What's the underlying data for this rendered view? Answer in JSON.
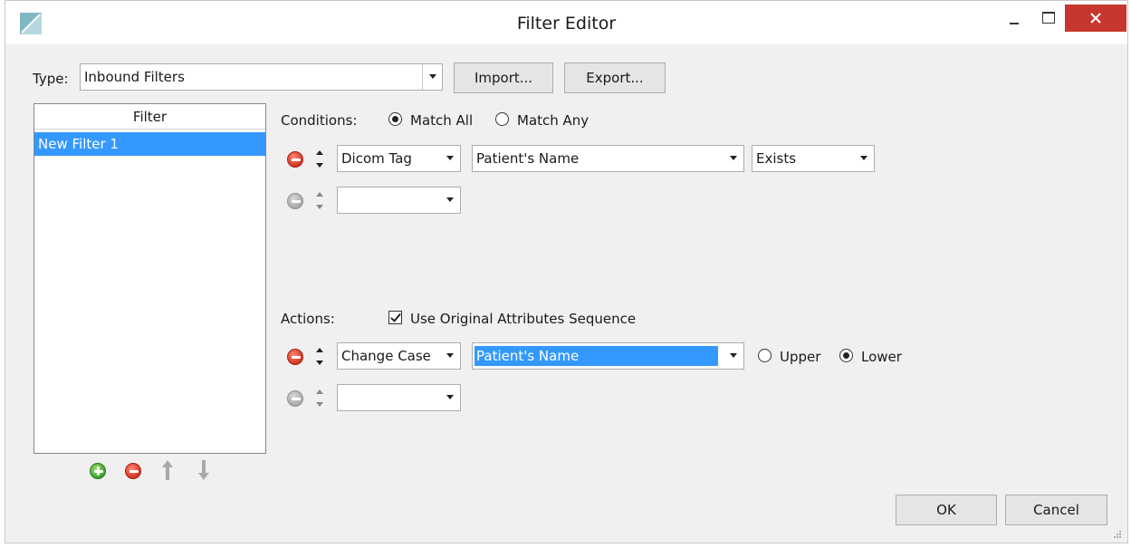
{
  "window": {
    "title": "Filter Editor"
  },
  "type_row": {
    "label": "Type:",
    "value": "Inbound Filters",
    "import_label": "Import...",
    "export_label": "Export..."
  },
  "filter_list": {
    "header": "Filter",
    "items": [
      "New Filter 1"
    ]
  },
  "conditions": {
    "label": "Conditions:",
    "match_all_label": "Match All",
    "match_any_label": "Match Any",
    "selected": "Match All",
    "row1": {
      "field": "Dicom Tag",
      "tag": "Patient's Name",
      "op": "Exists"
    },
    "row2": {
      "field": ""
    }
  },
  "actions": {
    "label": "Actions:",
    "use_original_label": "Use Original Attributes Sequence",
    "use_original_checked": true,
    "row1": {
      "action": "Change Case",
      "tag": "Patient's Name",
      "upper_label": "Upper",
      "lower_label": "Lower",
      "selected": "Lower"
    },
    "row2": {
      "action": ""
    }
  },
  "footer": {
    "ok_label": "OK",
    "cancel_label": "Cancel"
  },
  "colors": {
    "close_button": "#c7372f",
    "selection": "#3399ff",
    "remove_red": "#d2321f",
    "add_green": "#3aa02a"
  },
  "icons": {
    "app": "app-logo-icon",
    "add": "add-icon",
    "remove": "remove-icon",
    "move_up": "arrow-up-icon",
    "move_down": "arrow-down-icon"
  }
}
